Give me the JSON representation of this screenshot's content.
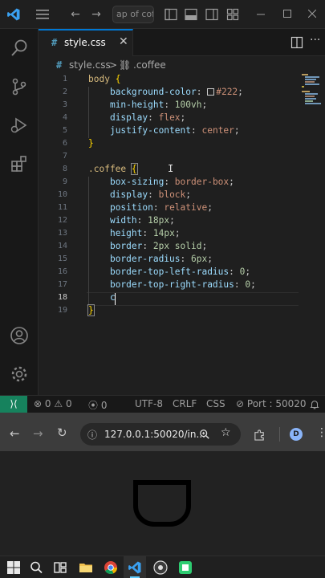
{
  "titlebar": {
    "search_text": "ap of cof"
  },
  "tab": {
    "file_icon": "#",
    "label": "style.css",
    "close": "✕"
  },
  "breadcrumb": {
    "file_icon": "#",
    "file": "style.css",
    "separator": ">",
    "symbol_icon": "⛓",
    "symbol": ".coffee"
  },
  "editor": {
    "line_numbers": [
      "1",
      "2",
      "3",
      "4",
      "5",
      "6",
      "7",
      "8",
      "9",
      "10",
      "11",
      "12",
      "13",
      "14",
      "15",
      "16",
      "17",
      "18",
      "19"
    ],
    "active_line": 18,
    "current_text": "c",
    "lines": {
      "l1_sel": "body",
      "l1_brace": "{",
      "l2_prop": "background-color",
      "l2_val": "#222",
      "l3_prop": "min-height",
      "l3_val": "100vh",
      "l4_prop": "display",
      "l4_val": "flex",
      "l5_prop": "justify-content",
      "l5_val": "center",
      "l6_brace": "}",
      "l8_sel": ".coffee",
      "l8_brace": "{",
      "l9_prop": "box-sizing",
      "l9_val": "border-box",
      "l10_prop": "display",
      "l10_val": "block",
      "l11_prop": "position",
      "l11_val": "relative",
      "l12_prop": "width",
      "l12_val": "18px",
      "l13_prop": "height",
      "l13_val": "14px",
      "l14_prop": "border",
      "l14_val": "2px solid",
      "l15_prop": "border-radius",
      "l15_val": "6px",
      "l16_prop": "border-top-left-radius",
      "l16_val": "0",
      "l17_prop": "border-top-right-radius",
      "l17_val": "0",
      "l19_brace": "}"
    },
    "swatch_color": "#222222"
  },
  "statusbar": {
    "remote_icon": "⟩⟨",
    "errors": "0",
    "warnings": "0",
    "ports": "0",
    "encoding": "UTF-8",
    "eol": "CRLF",
    "language": "CSS",
    "port_label": "Port : 50020"
  },
  "browser": {
    "url": "127.0.0.1:50020/in...",
    "profile_initial": "D"
  },
  "colors": {
    "accent": "#0078d4",
    "remote": "#16825d",
    "selector": "#d7ba7d",
    "property": "#9cdcfe",
    "value": "#ce9178",
    "number": "#b5cea8",
    "brace": "#ffd700"
  }
}
